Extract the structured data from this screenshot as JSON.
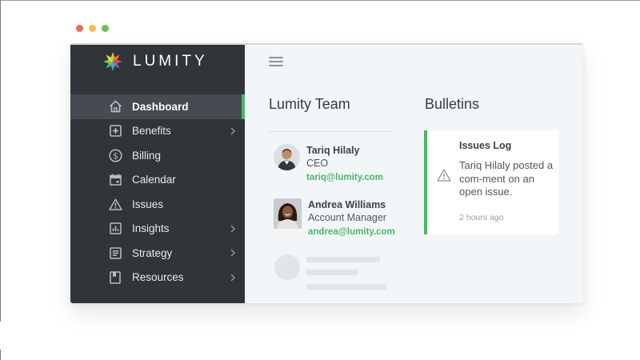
{
  "window_controls": {
    "close_color": "#ee6a5e",
    "minimize_color": "#f5bf4f",
    "maximize_color": "#61c454"
  },
  "brand": {
    "name": "LUMITY",
    "accent": "#4cb569"
  },
  "sidebar": {
    "items": [
      {
        "label": "Dashboard",
        "icon": "home-icon",
        "active": true,
        "has_submenu": false
      },
      {
        "label": "Benefits",
        "icon": "plus-square-icon",
        "active": false,
        "has_submenu": true
      },
      {
        "label": "Billing",
        "icon": "dollar-circle-icon",
        "active": false,
        "has_submenu": false
      },
      {
        "label": "Calendar",
        "icon": "calendar-icon",
        "active": false,
        "has_submenu": false
      },
      {
        "label": "Issues",
        "icon": "warning-icon",
        "active": false,
        "has_submenu": false
      },
      {
        "label": "Insights",
        "icon": "bar-chart-icon",
        "active": false,
        "has_submenu": true
      },
      {
        "label": "Strategy",
        "icon": "document-icon",
        "active": false,
        "has_submenu": true
      },
      {
        "label": "Resources",
        "icon": "bookmark-icon",
        "active": false,
        "has_submenu": true
      }
    ]
  },
  "team": {
    "title": "Lumity Team",
    "members": [
      {
        "name": "Tariq Hilaly",
        "role": "CEO",
        "email": "tariq@lumity.com"
      },
      {
        "name": "Andrea Williams",
        "role": "Account Manager",
        "email": "andrea@lumity.com"
      }
    ]
  },
  "bulletins": {
    "title": "Bulletins",
    "card": {
      "title": "Issues Log",
      "body": "Tariq Hilaly posted a com-ment on an open issue.",
      "time": "2 hours ago"
    }
  }
}
